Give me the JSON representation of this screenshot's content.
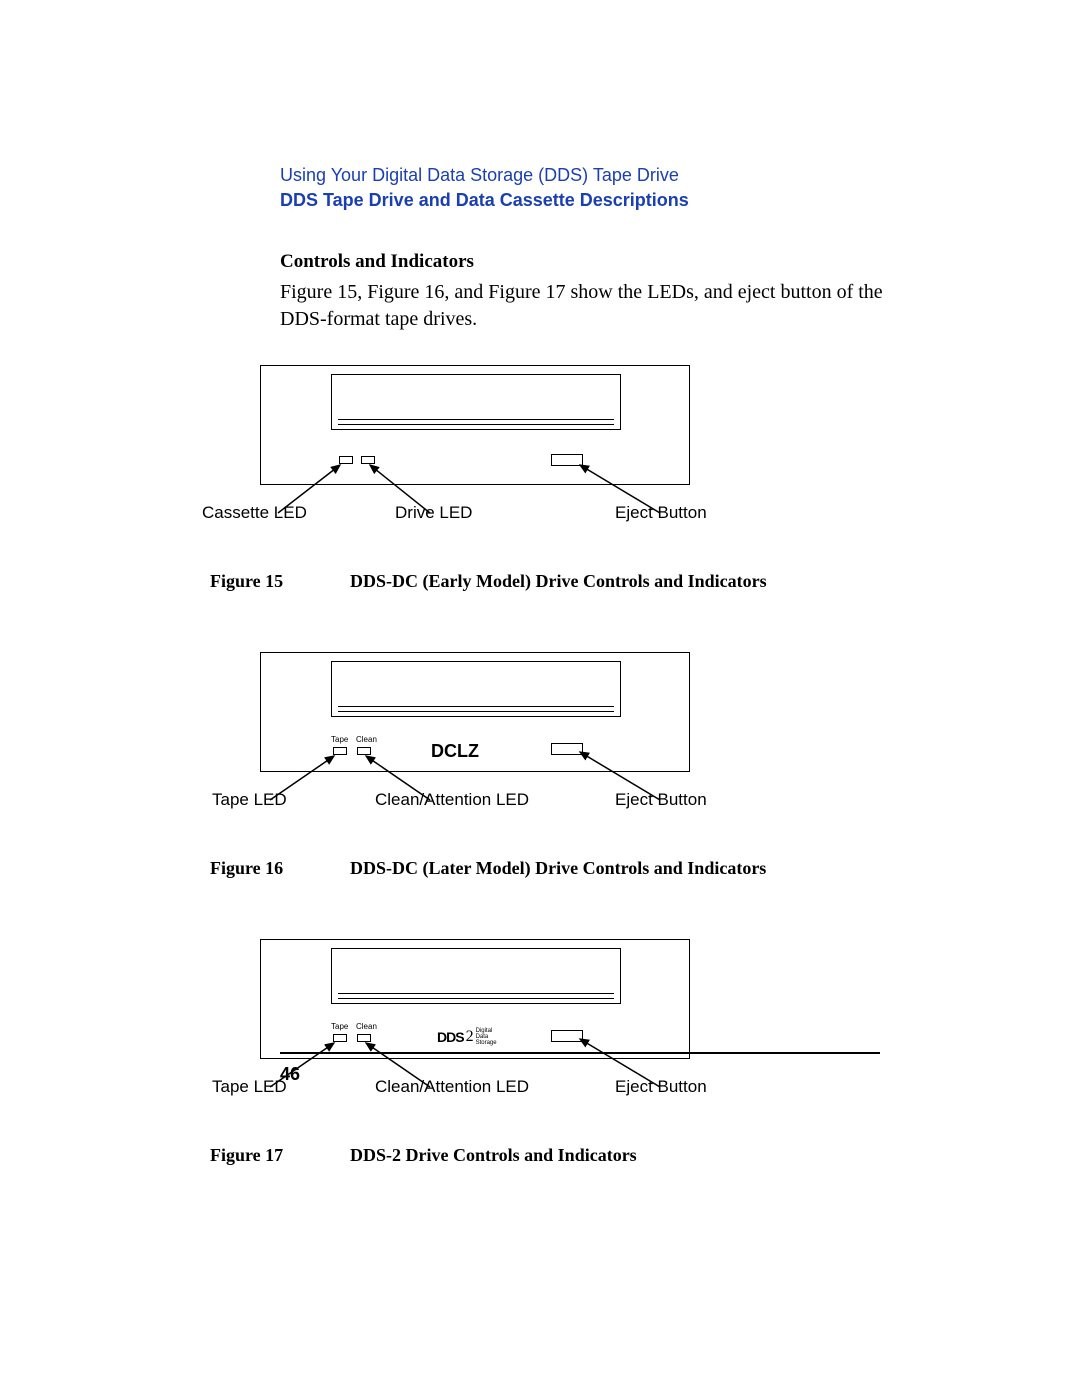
{
  "header": {
    "chapter": "Using Your Digital Data Storage (DDS) Tape Drive",
    "section": "DDS Tape Drive and Data Cassette Descriptions"
  },
  "subheading": "Controls and Indicators",
  "paragraph": "Figure 15, Figure 16, and Figure 17 show the LEDs, and eject button of the DDS-format tape drives.",
  "figures": [
    {
      "id": "fig15",
      "label": "Figure 15",
      "caption": "DDS-DC (Early Model) Drive Controls and Indicators",
      "callouts": {
        "left": "Cassette LED",
        "center": "Drive LED",
        "right": "Eject Button"
      }
    },
    {
      "id": "fig16",
      "label": "Figure 16",
      "caption": "DDS-DC (Later Model) Drive Controls and Indicators",
      "led_labels": {
        "left": "Tape",
        "right": "Clean"
      },
      "center_text": "DCLZ",
      "callouts": {
        "left": "Tape LED",
        "center": "Clean/Attention LED",
        "right": "Eject Button"
      }
    },
    {
      "id": "fig17",
      "label": "Figure 17",
      "caption": "DDS-2 Drive Controls and Indicators",
      "led_labels": {
        "left": "Tape",
        "right": "Clean"
      },
      "logo": {
        "brand": "DDS",
        "num": "2",
        "words": "Digital\nData\nStorage"
      },
      "callouts": {
        "left": "Tape LED",
        "center": "Clean/Attention LED",
        "right": "Eject Button"
      }
    }
  ],
  "page_number": "46"
}
